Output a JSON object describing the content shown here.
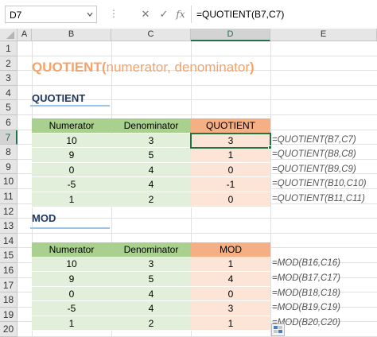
{
  "formula_bar": {
    "name_box": "D7",
    "dots": "⋮",
    "cancel": "✕",
    "enter": "✓",
    "fx": "fx",
    "formula": "=QUOTIENT(B7,C7)"
  },
  "columns": [
    "A",
    "B",
    "C",
    "D",
    "E"
  ],
  "selected_column": "D",
  "rows": [
    "1",
    "2",
    "3",
    "4",
    "5",
    "6",
    "7",
    "8",
    "9",
    "10",
    "11",
    "12",
    "13",
    "14",
    "15",
    "16",
    "17",
    "18",
    "19",
    "20"
  ],
  "selected_row": "7",
  "title": {
    "fn": "QUOTIENT(",
    "args": "numerator, denominator",
    "close": ")"
  },
  "quotient_section": {
    "heading": "QUOTIENT",
    "headers": [
      "Numerator",
      "Denominator",
      "QUOTIENT"
    ],
    "rows": [
      {
        "num": "10",
        "den": "3",
        "res": "3",
        "formula": "=QUOTIENT(B7,C7)"
      },
      {
        "num": "9",
        "den": "5",
        "res": "1",
        "formula": "=QUOTIENT(B8,C8)"
      },
      {
        "num": "0",
        "den": "4",
        "res": "0",
        "formula": "=QUOTIENT(B9,C9)"
      },
      {
        "num": "-5",
        "den": "4",
        "res": "-1",
        "formula": "=QUOTIENT(B10,C10)"
      },
      {
        "num": "1",
        "den": "2",
        "res": "0",
        "formula": "=QUOTIENT(B11,C11)"
      }
    ]
  },
  "mod_section": {
    "heading": "MOD",
    "headers": [
      "Numerator",
      "Denominator",
      "MOD"
    ],
    "rows": [
      {
        "num": "10",
        "den": "3",
        "res": "1",
        "formula": "=MOD(B16,C16)"
      },
      {
        "num": "9",
        "den": "5",
        "res": "4",
        "formula": "=MOD(B17,C17)"
      },
      {
        "num": "0",
        "den": "4",
        "res": "0",
        "formula": "=MOD(B18,C18)"
      },
      {
        "num": "-5",
        "den": "4",
        "res": "3",
        "formula": "=MOD(B19,C19)"
      },
      {
        "num": "1",
        "den": "2",
        "res": "1",
        "formula": "=MOD(B20,C20)"
      }
    ]
  },
  "colors": {
    "title": "#f3a36c",
    "section": "#1f3864",
    "header_green": "#a9d08e",
    "row_green": "#e2efda",
    "header_orange": "#f4b084",
    "row_orange": "#fce4d6",
    "selection": "#217346"
  }
}
